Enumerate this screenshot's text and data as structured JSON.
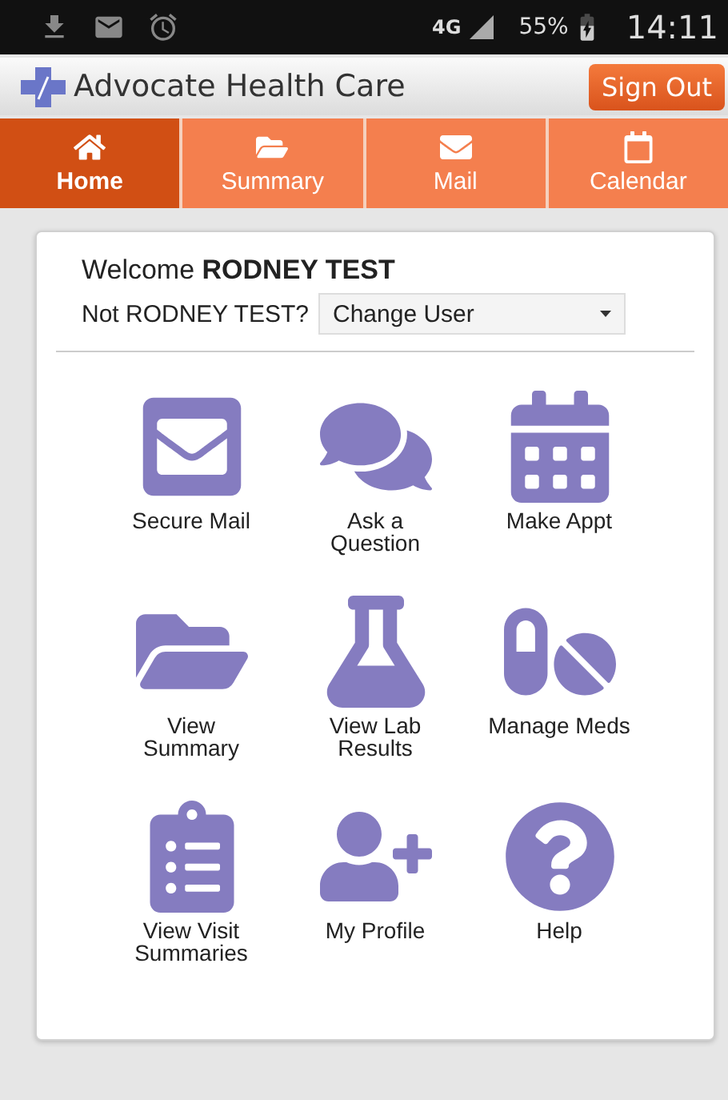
{
  "status_bar": {
    "icons": [
      {
        "kind": "download"
      },
      {
        "kind": "mail"
      },
      {
        "kind": "alarm"
      }
    ],
    "network": "4G",
    "battery": "55%",
    "time": "14:11"
  },
  "header": {
    "title": "Advocate Health Care",
    "sign_out": "Sign Out"
  },
  "tabs": [
    {
      "label": "Home",
      "kind": "home",
      "selected": true
    },
    {
      "label": "Summary",
      "kind": "folder",
      "selected": false
    },
    {
      "label": "Mail",
      "kind": "mail",
      "selected": false
    },
    {
      "label": "Calendar",
      "kind": "calendar",
      "selected": false
    }
  ],
  "welcome": "Welcome **RODNEY TEST**",
  "switch_user": {
    "prompt": "Not RODNEY TEST?",
    "value": "Change User"
  },
  "tiles": [
    {
      "label": "Secure Mail",
      "kind": "mail"
    },
    {
      "label": "Ask a\nQuestion",
      "kind": "chat"
    },
    {
      "label": "Make Appt",
      "kind": "calendar"
    },
    {
      "label": "View\nSummary",
      "kind": "folder"
    },
    {
      "label": "View Lab\nResults",
      "kind": "flask"
    },
    {
      "label": "Manage Meds",
      "kind": "pills"
    },
    {
      "label": "View Visit\nSummaries",
      "kind": "clipboard"
    },
    {
      "label": "My Profile",
      "kind": "user-plus"
    },
    {
      "label": "Help",
      "kind": "help"
    }
  ]
}
